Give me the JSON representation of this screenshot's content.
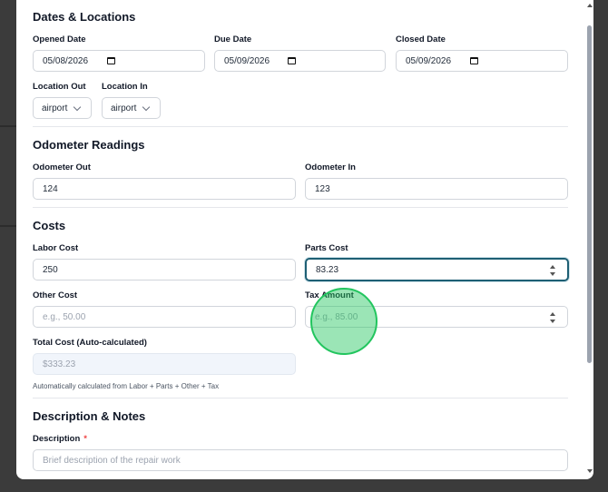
{
  "sections": {
    "dates": "Dates & Locations",
    "odometer": "Odometer Readings",
    "costs": "Costs",
    "description": "Description & Notes"
  },
  "fields": {
    "opened_date": {
      "label": "Opened Date",
      "value": "05/08/2026"
    },
    "due_date": {
      "label": "Due Date",
      "value": "05/09/2026"
    },
    "closed_date": {
      "label": "Closed Date",
      "value": "05/09/2026"
    },
    "location_out": {
      "label": "Location Out",
      "value": "airport"
    },
    "location_in": {
      "label": "Location In",
      "value": "airport"
    },
    "odometer_out": {
      "label": "Odometer Out",
      "value": "124"
    },
    "odometer_in": {
      "label": "Odometer In",
      "value": "123"
    },
    "labor_cost": {
      "label": "Labor Cost",
      "value": "250"
    },
    "parts_cost": {
      "label": "Parts Cost",
      "value": "83.23"
    },
    "other_cost": {
      "label": "Other Cost",
      "placeholder": "e.g., 50.00"
    },
    "tax_amount": {
      "label": "Tax Amount",
      "placeholder": "e.g., 85.00"
    },
    "total_cost": {
      "label": "Total Cost (Auto-calculated)",
      "value": "$333.23",
      "helper": "Automatically calculated from Labor + Parts + Other + Tax"
    },
    "description": {
      "label": "Description",
      "required_mark": "*",
      "placeholder": "Brief description of the repair work"
    }
  },
  "icons": {
    "date": "calendar-icon",
    "select": "chevron-down-icon",
    "number": "spinner-arrows-icon"
  },
  "colors": {
    "focus_border": "#1e5f74",
    "cursor_highlight": "#22c55e",
    "required": "#ef4444"
  }
}
